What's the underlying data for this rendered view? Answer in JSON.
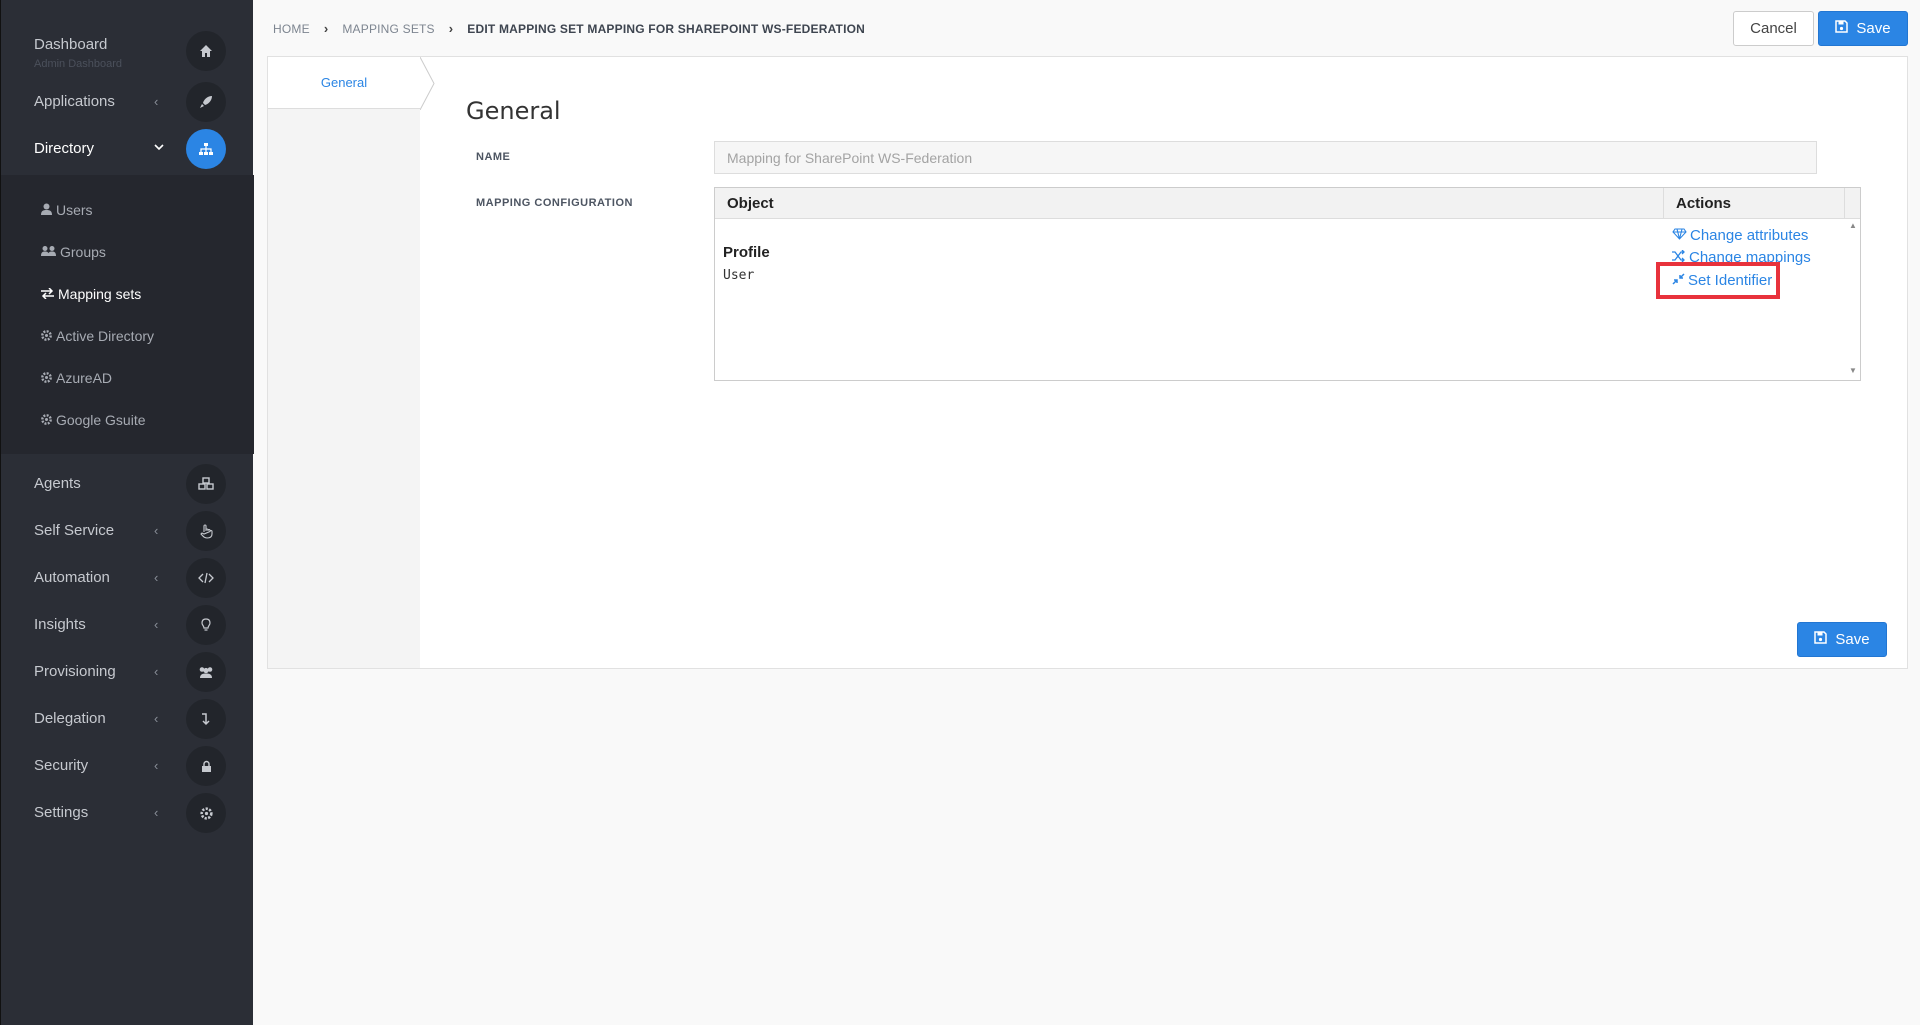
{
  "sidebar": {
    "items": [
      {
        "label": "Dashboard",
        "sub": "Admin Dashboard",
        "icon": "home-icon"
      },
      {
        "label": "Applications",
        "icon": "rocket-icon"
      },
      {
        "label": "Directory",
        "icon": "sitemap-icon"
      },
      {
        "label": "Agents",
        "icon": "cubes-icon"
      },
      {
        "label": "Self Service",
        "icon": "hand-icon"
      },
      {
        "label": "Automation",
        "icon": "code-icon"
      },
      {
        "label": "Insights",
        "icon": "lightbulb-icon"
      },
      {
        "label": "Provisioning",
        "icon": "users-icon"
      },
      {
        "label": "Delegation",
        "icon": "level-down-icon"
      },
      {
        "label": "Security",
        "icon": "lock-icon"
      },
      {
        "label": "Settings",
        "icon": "gear-icon"
      }
    ],
    "directory_sub": [
      {
        "label": "Users",
        "icon": "user-icon"
      },
      {
        "label": "Groups",
        "icon": "users-icon"
      },
      {
        "label": "Mapping sets",
        "icon": "exchange-icon"
      },
      {
        "label": "Active Directory",
        "icon": "gear-icon"
      },
      {
        "label": "AzureAD",
        "icon": "gear-icon"
      },
      {
        "label": "Google Gsuite",
        "icon": "gear-icon"
      }
    ]
  },
  "breadcrumb": {
    "home": "HOME",
    "mapping_sets": "MAPPING SETS",
    "current": "EDIT MAPPING SET MAPPING FOR SHAREPOINT WS-FEDERATION"
  },
  "toolbar": {
    "cancel_label": "Cancel",
    "save_label": "Save"
  },
  "tabs": {
    "general": "General"
  },
  "form": {
    "section_title": "General",
    "name_label": "NAME",
    "name_value": "Mapping for SharePoint WS-Federation",
    "mapping_label": "MAPPING CONFIGURATION"
  },
  "table": {
    "col_object": "Object",
    "col_actions": "Actions",
    "row": {
      "name": "Profile",
      "type": "User"
    },
    "actions": {
      "change_attributes": "Change attributes",
      "change_mappings": "Change mappings",
      "set_identifier": "Set Identifier"
    }
  },
  "colors": {
    "accent": "#2b85e4",
    "highlight": "#e8323c",
    "sidebar": "#2b2e36"
  }
}
